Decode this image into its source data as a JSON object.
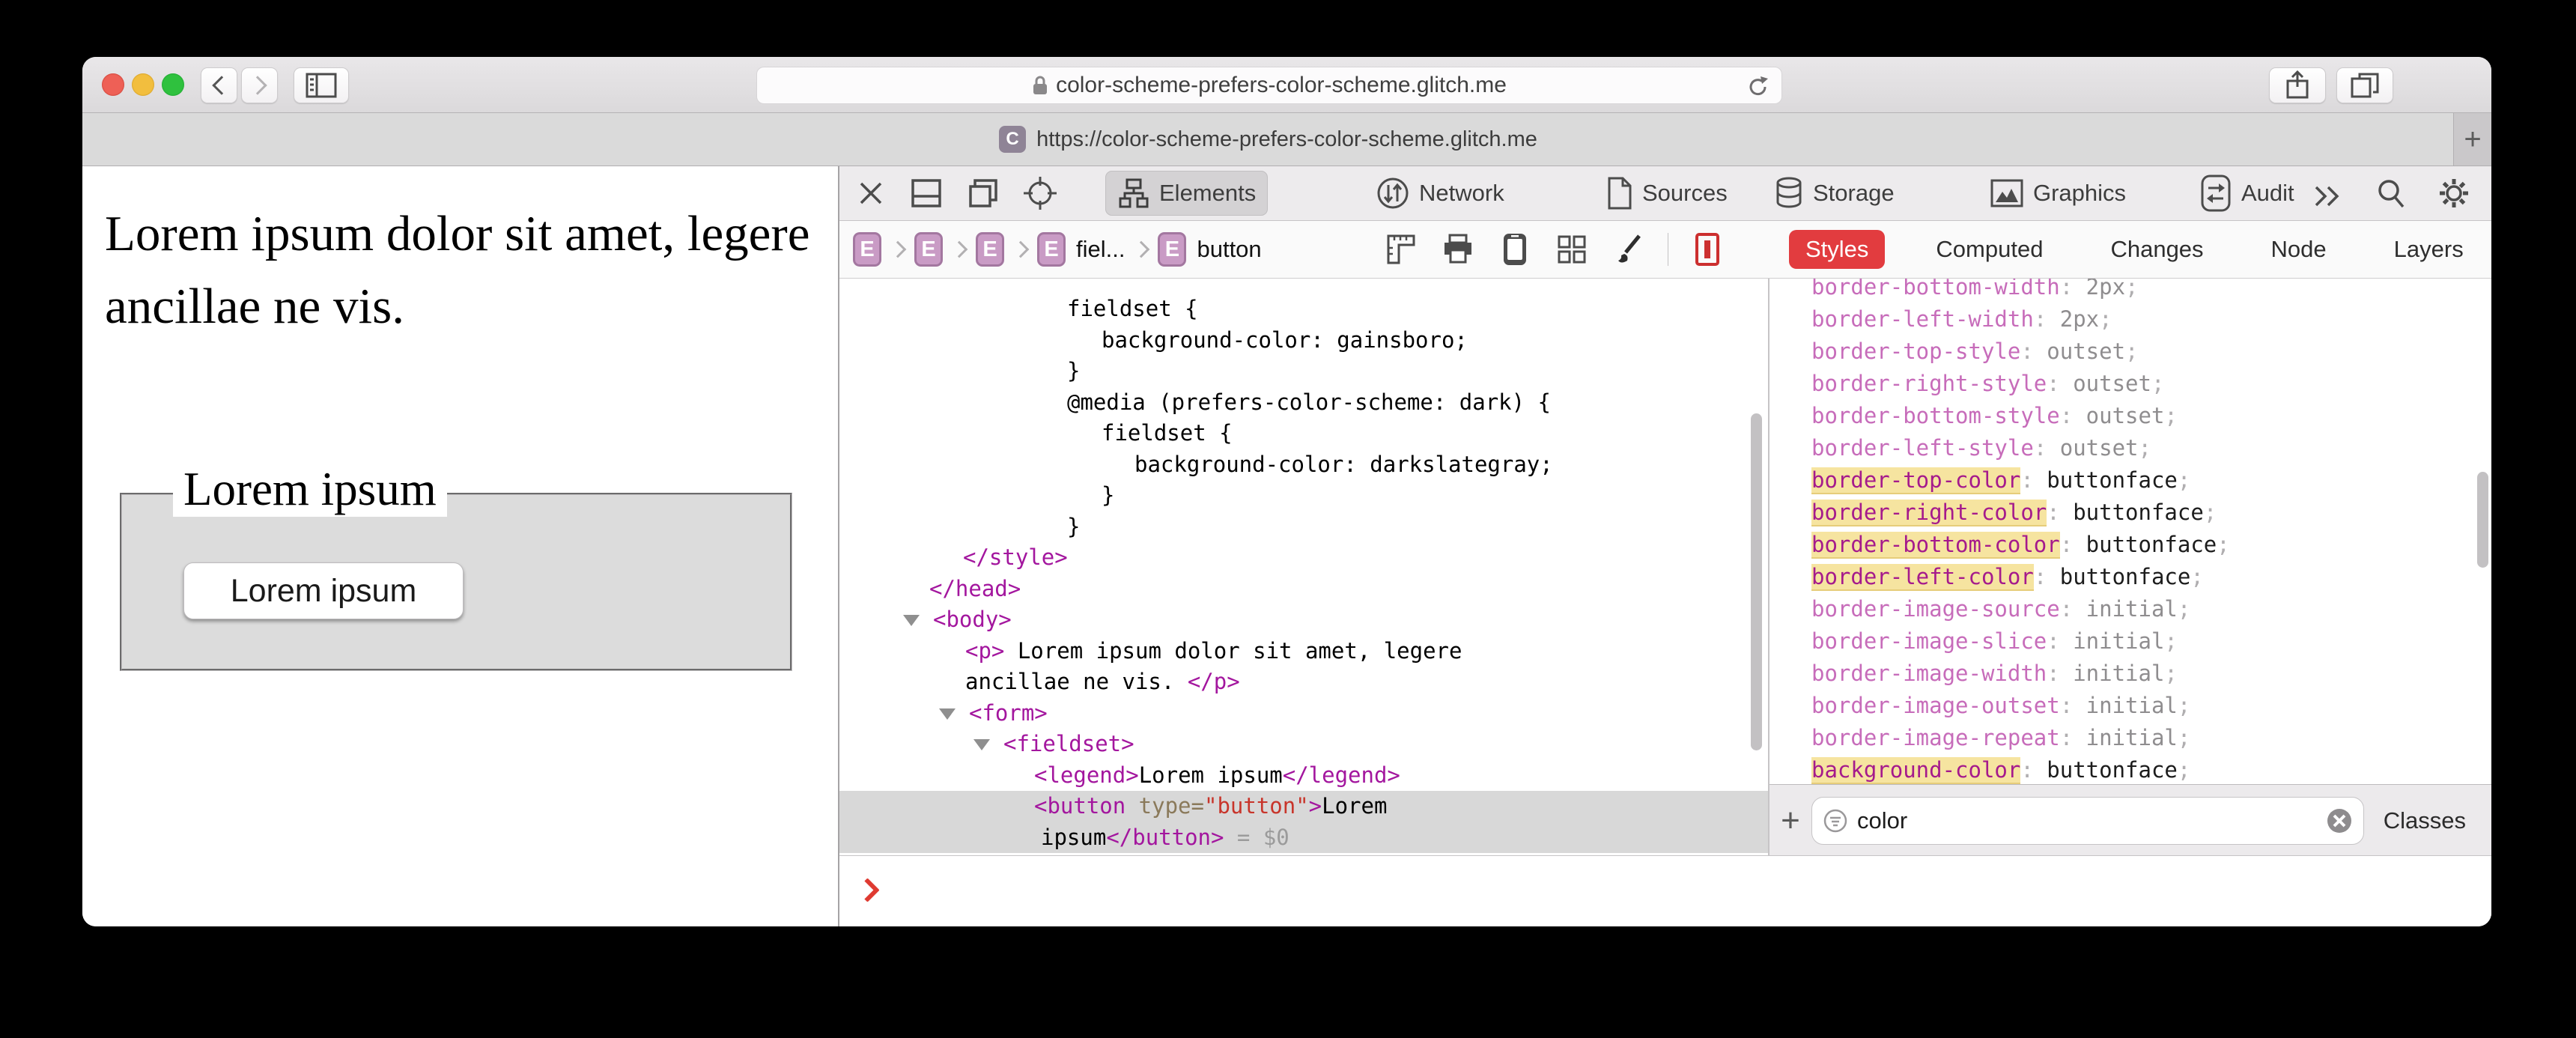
{
  "browser": {
    "url": "color-scheme-prefers-color-scheme.glitch.me",
    "tab_title": "https://color-scheme-prefers-color-scheme.glitch.me",
    "favicon_letter": "C",
    "new_tab_label": "+"
  },
  "page": {
    "paragraph": "Lorem ipsum dolor sit amet, legere ancillae ne vis.",
    "fieldset_legend": "Lorem ipsum",
    "button_label": "Lorem ipsum"
  },
  "devtools": {
    "toolbar_tabs": [
      {
        "icon": "elements-icon",
        "label": "Elements",
        "active": true
      },
      {
        "icon": "network-icon",
        "label": "Network",
        "active": false
      },
      {
        "icon": "sources-icon",
        "label": "Sources",
        "active": false
      },
      {
        "icon": "storage-icon",
        "label": "Storage",
        "active": false
      },
      {
        "icon": "graphics-icon",
        "label": "Graphics",
        "active": false
      },
      {
        "icon": "audit-icon",
        "label": "Audit",
        "active": false
      }
    ],
    "breadcrumbs": [
      {
        "badge": "E",
        "label": ""
      },
      {
        "badge": "E",
        "label": ""
      },
      {
        "badge": "E",
        "label": ""
      },
      {
        "badge": "E",
        "label": "fiel..."
      },
      {
        "badge": "E",
        "label": "button"
      }
    ],
    "styles_sidebar_tabs": [
      {
        "label": "Styles",
        "active": true
      },
      {
        "label": "Computed",
        "active": false
      },
      {
        "label": "Changes",
        "active": false
      },
      {
        "label": "Node",
        "active": false
      },
      {
        "label": "Layers",
        "active": false
      }
    ],
    "code_lines": [
      {
        "ind": 304,
        "tri": false,
        "hl": false,
        "seg": [
          [
            "p",
            "fieldset {"
          ]
        ]
      },
      {
        "ind": 350,
        "tri": false,
        "hl": false,
        "seg": [
          [
            "p",
            "background-color: gainsboro;"
          ]
        ]
      },
      {
        "ind": 304,
        "tri": false,
        "hl": false,
        "seg": [
          [
            "p",
            "}"
          ]
        ]
      },
      {
        "ind": 304,
        "tri": false,
        "hl": false,
        "seg": [
          [
            "p",
            "@media (prefers-color-scheme: dark) {"
          ]
        ]
      },
      {
        "ind": 350,
        "tri": false,
        "hl": false,
        "seg": [
          [
            "p",
            "fieldset {"
          ]
        ]
      },
      {
        "ind": 394,
        "tri": false,
        "hl": false,
        "seg": [
          [
            "p",
            "background-color: darkslategray;"
          ]
        ]
      },
      {
        "ind": 350,
        "tri": false,
        "hl": false,
        "seg": [
          [
            "p",
            "}"
          ]
        ]
      },
      {
        "ind": 304,
        "tri": false,
        "hl": false,
        "seg": [
          [
            "p",
            "}"
          ]
        ]
      },
      {
        "ind": 165,
        "tri": false,
        "hl": false,
        "seg": [
          [
            "t",
            "</style>"
          ]
        ]
      },
      {
        "ind": 120,
        "tri": false,
        "hl": false,
        "seg": [
          [
            "t",
            "</head>"
          ]
        ]
      },
      {
        "ind": 125,
        "tri": true,
        "hl": false,
        "seg": [
          [
            "t",
            "<body>"
          ]
        ]
      },
      {
        "ind": 168,
        "tri": false,
        "hl": false,
        "seg": [
          [
            "t",
            "<p>"
          ],
          [
            "p",
            " Lorem ipsum dolor sit amet, legere"
          ]
        ]
      },
      {
        "ind": 168,
        "tri": false,
        "hl": false,
        "seg": [
          [
            "p",
            "ancillae ne vis. "
          ],
          [
            "t",
            "</p>"
          ]
        ]
      },
      {
        "ind": 173,
        "tri": true,
        "hl": false,
        "seg": [
          [
            "t",
            "<form>"
          ]
        ]
      },
      {
        "ind": 219,
        "tri": true,
        "hl": false,
        "seg": [
          [
            "t",
            "<fieldset>"
          ]
        ]
      },
      {
        "ind": 260,
        "tri": false,
        "hl": false,
        "seg": [
          [
            "t",
            "<legend>"
          ],
          [
            "p",
            "Lorem ipsum"
          ],
          [
            "t",
            "</legend>"
          ]
        ]
      },
      {
        "ind": 260,
        "tri": false,
        "hl": true,
        "seg": [
          [
            "t",
            "<button"
          ],
          [
            "a",
            " type="
          ],
          [
            "v",
            "\"button\""
          ],
          [
            "t",
            ">"
          ],
          [
            "p",
            "Lorem"
          ]
        ]
      },
      {
        "ind": 269,
        "tri": false,
        "hl": true,
        "seg": [
          [
            "p",
            "ipsum"
          ],
          [
            "t",
            "</button>"
          ],
          [
            "m",
            " = $0"
          ]
        ]
      }
    ],
    "css_properties": [
      {
        "name": "border-bottom-width",
        "value": "2px",
        "match": false,
        "dark": false
      },
      {
        "name": "border-left-width",
        "value": "2px",
        "match": false,
        "dark": false
      },
      {
        "name": "border-top-style",
        "value": "outset",
        "match": false,
        "dark": false
      },
      {
        "name": "border-right-style",
        "value": "outset",
        "match": false,
        "dark": false
      },
      {
        "name": "border-bottom-style",
        "value": "outset",
        "match": false,
        "dark": false
      },
      {
        "name": "border-left-style",
        "value": "outset",
        "match": false,
        "dark": false
      },
      {
        "name": "border-top-color",
        "value": "buttonface",
        "match": true,
        "dark": true
      },
      {
        "name": "border-right-color",
        "value": "buttonface",
        "match": true,
        "dark": true
      },
      {
        "name": "border-bottom-color",
        "value": "buttonface",
        "match": true,
        "dark": true
      },
      {
        "name": "border-left-color",
        "value": "buttonface",
        "match": true,
        "dark": true
      },
      {
        "name": "border-image-source",
        "value": "initial",
        "match": false,
        "dark": false
      },
      {
        "name": "border-image-slice",
        "value": "initial",
        "match": false,
        "dark": false
      },
      {
        "name": "border-image-width",
        "value": "initial",
        "match": false,
        "dark": false
      },
      {
        "name": "border-image-outset",
        "value": "initial",
        "match": false,
        "dark": false
      },
      {
        "name": "border-image-repeat",
        "value": "initial",
        "match": false,
        "dark": false
      },
      {
        "name": "background-color",
        "value": "buttonface",
        "match": true,
        "dark": true
      }
    ],
    "filter_bar": {
      "add_label": "+",
      "filter_value": "color",
      "classes_label": "Classes"
    },
    "console_prompt": ">"
  },
  "colors": {
    "accent_red": "#e23c3f",
    "highlight_yellow": "#f6e4a0",
    "tag_magenta": "#a3169e",
    "badge_purple": "#c99bc5",
    "selected_row_gray": "#d8d8d8",
    "fieldset_gainsboro": "#dcdcdc"
  }
}
